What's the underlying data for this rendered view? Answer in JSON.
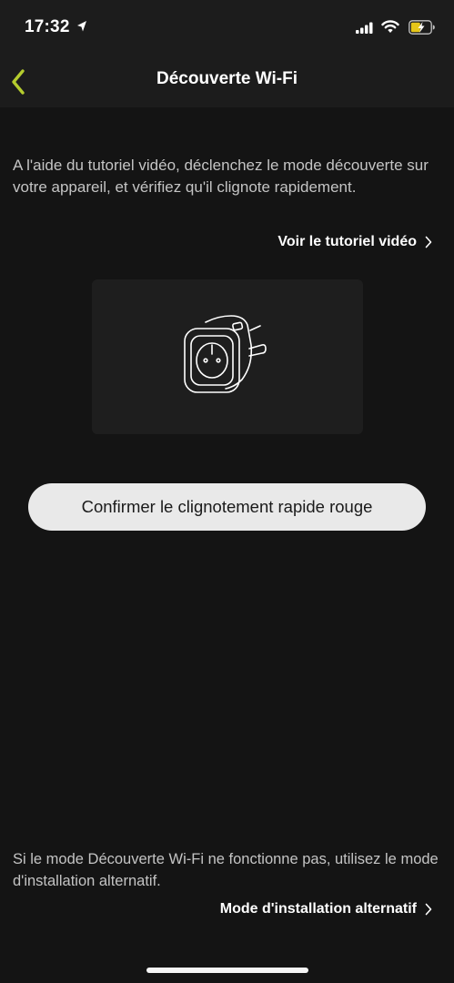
{
  "status_bar": {
    "time": "17:32"
  },
  "nav": {
    "title": "Découverte Wi-Fi"
  },
  "instructions": {
    "text": "A l'aide du tutoriel vidéo, déclenchez le mode découverte sur votre appareil, et vérifiez qu'il clignote rapidement.",
    "tutorial_link": "Voir le tutoriel vidéo"
  },
  "confirm_button": "Confirmer le clignotement rapide rouge",
  "alternative": {
    "text": "Si le mode Découverte Wi-Fi ne fonctionne pas, utilisez le mode d'installation alternatif.",
    "link": "Mode d'installation alternatif"
  },
  "colors": {
    "accent": "#b5cc2e",
    "background": "#141414",
    "bar_background": "#1c1c1c",
    "button_background": "#e9e9e9"
  },
  "icons": {
    "back": "chevron-left-icon",
    "link_arrow": "chevron-right-icon",
    "device": "smart-plug-illustration"
  }
}
